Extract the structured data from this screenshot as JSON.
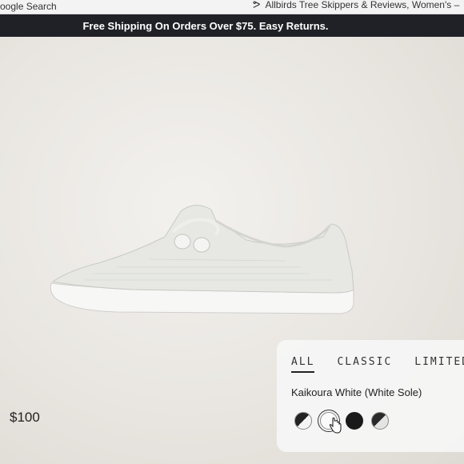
{
  "browser": {
    "left_tab": "oogle Search",
    "right_tab": "Allbirds Tree Skippers & Reviews, Women's –"
  },
  "announcement": "Free Shipping On Orders Over $75. Easy Returns.",
  "product": {
    "price": "$100",
    "color_name": "Kaikoura White (White Sole)"
  },
  "filter_tabs": [
    {
      "label": "ALL",
      "active": true
    },
    {
      "label": "CLASSIC",
      "active": false
    },
    {
      "label": "LIMITED",
      "active": false
    }
  ],
  "swatches": [
    {
      "icon": "black-white-split-swatch"
    },
    {
      "icon": "white-swatch",
      "selected": true
    },
    {
      "icon": "black-swatch"
    },
    {
      "icon": "grey-white-split-swatch"
    }
  ],
  "colors": {
    "announcement_bg": "#202126",
    "hero_bg": "#ece9e4",
    "panel_bg": "#f6f6f6"
  }
}
